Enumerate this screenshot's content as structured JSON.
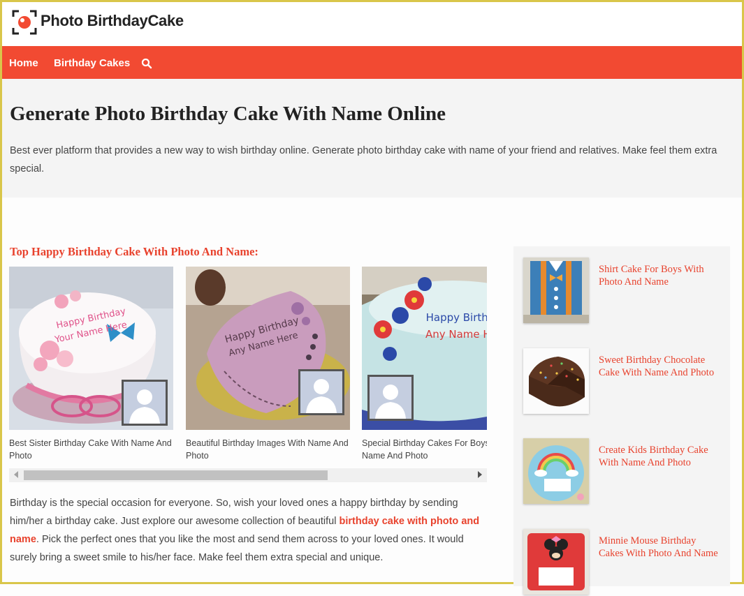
{
  "site": {
    "logo_text": "Photo BirthdayCake"
  },
  "nav": {
    "home": "Home",
    "birthday_cakes": "Birthday Cakes",
    "search_icon": "search-icon"
  },
  "hero": {
    "title": "Generate Photo Birthday Cake With Name Online",
    "description": "Best ever platform that provides a new way to wish birthday online. Generate photo birthday cake with name of your friend and relatives. Make feel them extra special."
  },
  "main": {
    "section_title": "Top Happy Birthday Cake With Photo And Name:",
    "cards": [
      {
        "caption": "Best Sister Birthday Cake With Name And Photo",
        "cake_text": "Happy Birthday\nYour Name Here"
      },
      {
        "caption": "Beautiful Birthday Images With Name And Photo",
        "cake_text": "Happy Birthday\nAny Name Here"
      },
      {
        "caption": "Special Birthday Cakes For Boys With Name And Photo",
        "cake_text": "Happy Birthday\nAny Name Here"
      }
    ],
    "body_before": "Birthday is the special occasion for everyone. So, wish your loved ones a happy birthday by sending him/her a birthday cake. Just explore our awesome collection of beautiful ",
    "body_link": "birthday cake with photo and name",
    "body_after": ". Pick the perfect ones that you like the most and send them across to your loved ones. It would surely bring a sweet smile to his/her face. Make feel them extra special and unique."
  },
  "sidebar": {
    "items": [
      {
        "label": "Shirt Cake For Boys With Photo And Name"
      },
      {
        "label": "Sweet Birthday Chocolate Cake With Name And Photo"
      },
      {
        "label": "Create Kids Birthday Cake With Name And Photo"
      },
      {
        "label": "Minnie Mouse Birthday Cakes With Photo And Name"
      }
    ]
  },
  "colors": {
    "accent": "#f24a32",
    "link": "#e8422d",
    "hero_bg": "#f4f4f4",
    "frame": "#d9c64a"
  }
}
